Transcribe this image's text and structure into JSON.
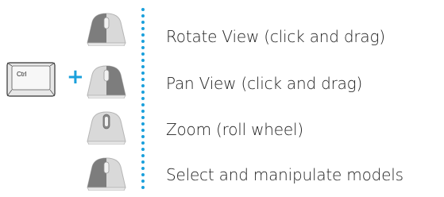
{
  "colors": {
    "accent": "#1aa0dc",
    "text": "#222222",
    "mouse_highlight": "#7d7d7d",
    "mouse_body": "#d9d9d9"
  },
  "modifier": {
    "key_label": "Ctrl",
    "plus_symbol": "+"
  },
  "controls": [
    {
      "label": "Rotate View (click and drag)",
      "icon": "mouse-left-button-icon"
    },
    {
      "label": "Pan View (click and drag)",
      "icon": "mouse-right-button-icon"
    },
    {
      "label": "Zoom (roll wheel)",
      "icon": "mouse-wheel-icon"
    },
    {
      "label": "Select and manipulate models",
      "icon": "mouse-left-button-icon"
    }
  ]
}
